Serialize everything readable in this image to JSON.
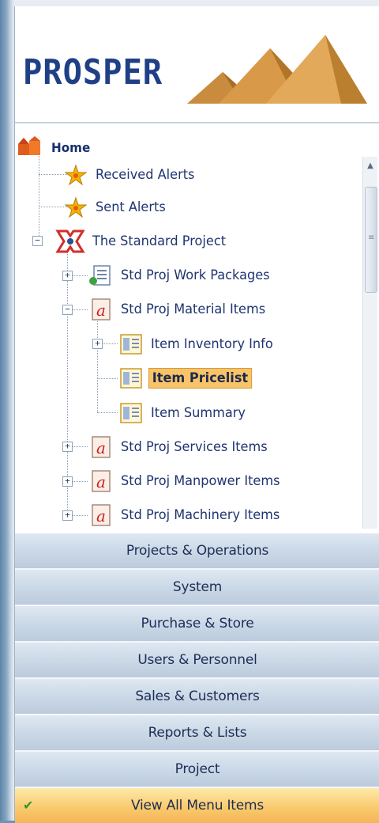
{
  "logo": {
    "text": "PROSPER"
  },
  "tree": {
    "home": "Home",
    "received_alerts": "Received Alerts",
    "sent_alerts": "Sent Alerts",
    "project": "The Standard Project",
    "work_packages": "Std Proj Work Packages",
    "material_items": "Std Proj Material Items",
    "item_inventory_info": "Item Inventory Info",
    "item_pricelist": "Item Pricelist",
    "item_summary": "Item Summary",
    "services_items": "Std Proj Services Items",
    "manpower_items": "Std Proj Manpower Items",
    "machinery_items": "Std Proj Machinery Items"
  },
  "nav": {
    "projects_operations": "Projects & Operations",
    "system": "System",
    "purchase_store": "Purchase & Store",
    "users_personnel": "Users & Personnel",
    "sales_customers": "Sales & Customers",
    "reports_lists": "Reports & Lists",
    "project": "Project",
    "view_all": "View All Menu Items"
  },
  "colors": {
    "selected": "#f8c46a",
    "nav_button": "#c9d7e6",
    "active_button": "#f9c86a",
    "link_text": "#1f3470"
  }
}
